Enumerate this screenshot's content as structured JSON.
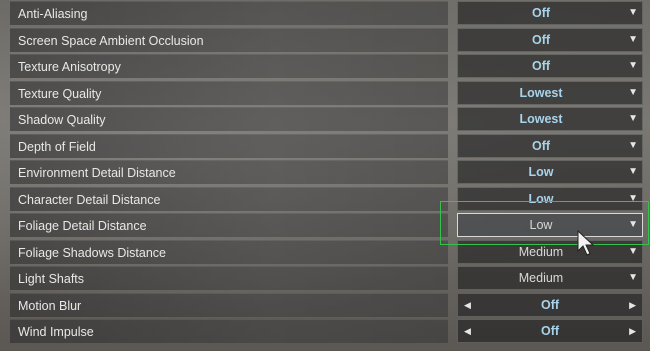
{
  "settings": [
    {
      "label": "Anti-Aliasing",
      "value": "Off",
      "control": "dropdown"
    },
    {
      "label": "Screen Space Ambient Occlusion",
      "value": "Off",
      "control": "dropdown"
    },
    {
      "label": "Texture Anisotropy",
      "value": "Off",
      "control": "dropdown"
    },
    {
      "label": "Texture Quality",
      "value": "Lowest",
      "control": "dropdown"
    },
    {
      "label": "Shadow Quality",
      "value": "Lowest",
      "control": "dropdown"
    },
    {
      "label": "Depth of Field",
      "value": "Off",
      "control": "dropdown"
    },
    {
      "label": "Environment Detail Distance",
      "value": "Low",
      "control": "dropdown"
    },
    {
      "label": "Character Detail Distance",
      "value": "Low",
      "control": "dropdown"
    },
    {
      "label": "Foliage Detail Distance",
      "value": "Low",
      "control": "dropdown",
      "highlighted": true
    },
    {
      "label": "Foliage Shadows Distance",
      "value": "Medium",
      "control": "dropdown",
      "muted": true
    },
    {
      "label": "Light Shafts",
      "value": "Medium",
      "control": "dropdown",
      "muted": true
    },
    {
      "label": "Motion Blur",
      "value": "Off",
      "control": "stepper"
    },
    {
      "label": "Wind Impulse",
      "value": "Off",
      "control": "stepper"
    }
  ],
  "icons": {
    "dropdown": "triangle-down-icon",
    "stepper_left": "triangle-left-icon",
    "stepper_right": "triangle-right-icon",
    "cursor": "mouse-pointer-icon"
  },
  "colors": {
    "value_text": "#a8d3ea",
    "muted_value_text": "#d8d8d8",
    "highlight_frame": "#33c24a"
  }
}
